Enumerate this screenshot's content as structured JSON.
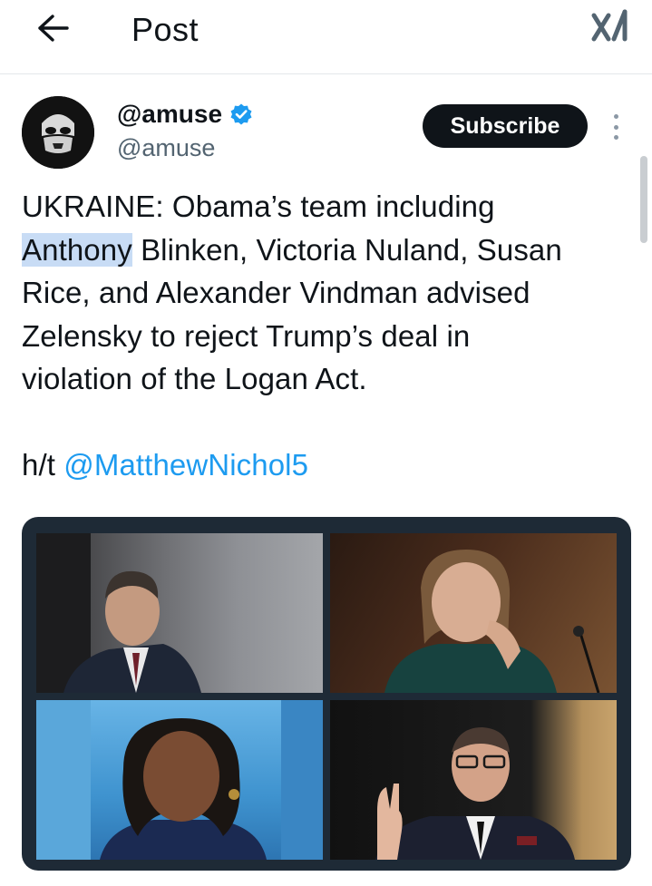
{
  "header": {
    "title": "Post",
    "back_icon": "arrow-left-icon",
    "grok_icon": "grok-icon"
  },
  "author": {
    "display_name": "@amuse",
    "handle": "@amuse",
    "verified": true,
    "verified_color": "#1d9bf0"
  },
  "actions": {
    "subscribe_label": "Subscribe",
    "more_icon": "more-vertical-icon"
  },
  "post": {
    "line1": "UKRAINE: Obama’s team including",
    "highlighted_word": "Anthony",
    "line2_rest": " Blinken, Victoria Nuland, Susan",
    "line3": "Rice, and Alexander Vindman advised",
    "line4": "Zelensky to reject Trump’s deal in",
    "line5": "violation of the Logan Act.",
    "ht_prefix": "h/t ",
    "mention": "@MatthewNichol5"
  },
  "media": {
    "photo_count": 4
  },
  "colors": {
    "link": "#1d9bf0",
    "text": "#0f1419",
    "secondary": "#536471",
    "highlight": "#c8dcf5"
  }
}
